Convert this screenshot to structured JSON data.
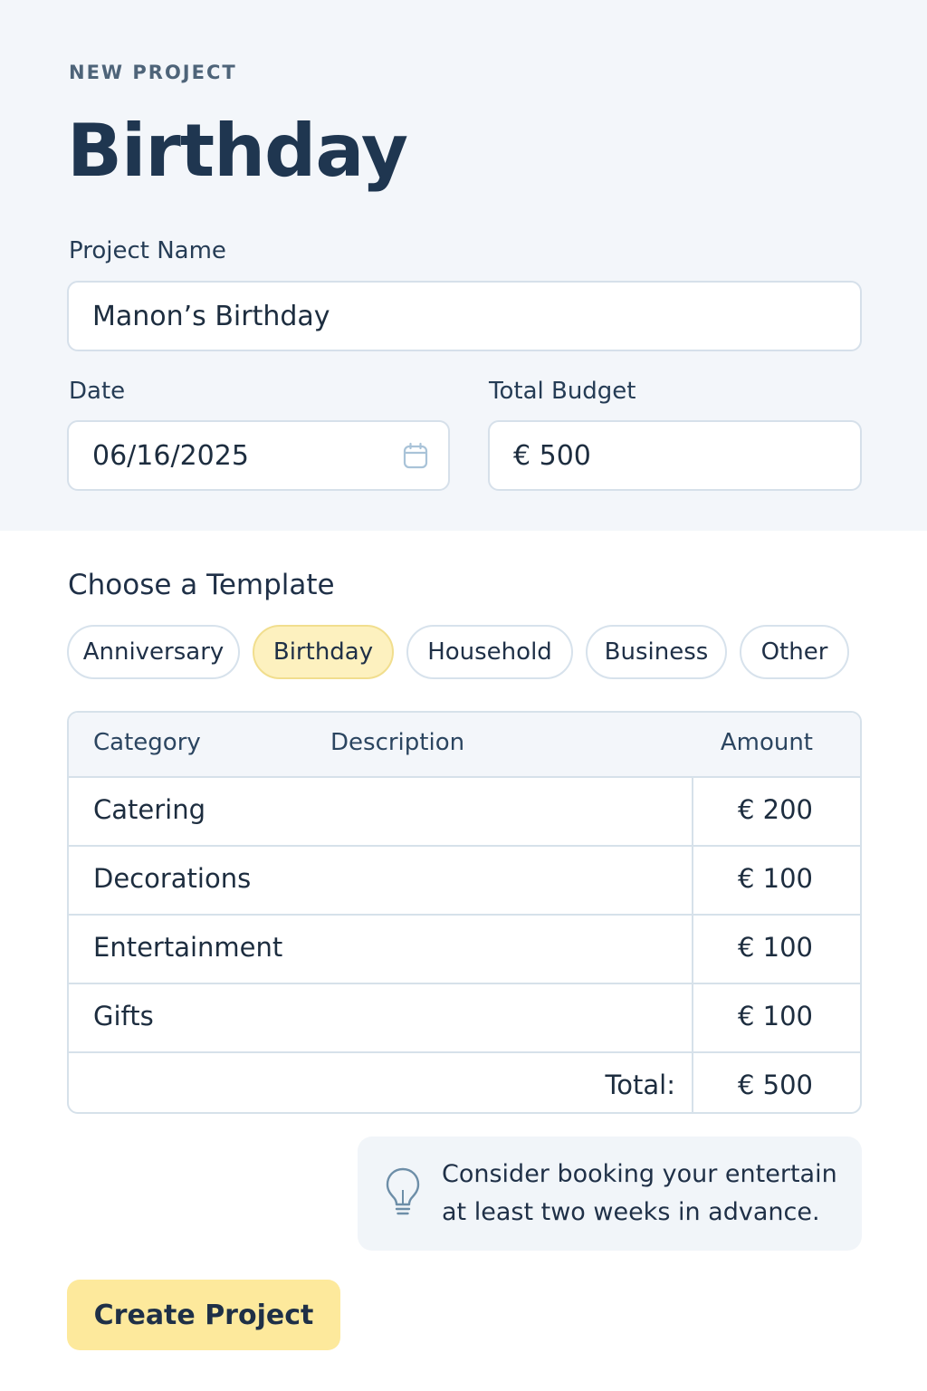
{
  "header": {
    "eyebrow": "NEW PROJECT",
    "title": "Birthday"
  },
  "form": {
    "project_name_label": "Project Name",
    "project_name_value": "Manon’s Birthday",
    "date_label": "Date",
    "date_value": "06/16/2025",
    "date_icon": "calendar-icon",
    "budget_label": "Total Budget",
    "budget_value": "€ 500"
  },
  "templates": {
    "title": "Choose a Template",
    "chips": [
      "Anniversary",
      "Birthday",
      "Household",
      "Business",
      "Other"
    ],
    "selected": "Birthday"
  },
  "table": {
    "headers": {
      "category": "Category",
      "description": "Description",
      "amount": "Amount"
    },
    "rows": [
      {
        "category": "Catering",
        "amount": "€ 200"
      },
      {
        "category": "Decorations",
        "amount": "€ 100"
      },
      {
        "category": "Entertainment",
        "amount": "€ 100"
      },
      {
        "category": "Gifts",
        "amount": "€ 100"
      }
    ],
    "total_label": "Total:",
    "total_value": "€ 500"
  },
  "tip": {
    "icon": "lightbulb-icon",
    "line1": "Consider booking your entertain",
    "line2": "at least two weeks in advance."
  },
  "actions": {
    "create_label": "Create Project"
  },
  "colors": {
    "panel_bg": "#f3f6fa",
    "accent_yellow": "#fde99c",
    "selected_chip": "#fdf1bf",
    "title_text": "#1f3650",
    "border": "#d6e0ea"
  }
}
